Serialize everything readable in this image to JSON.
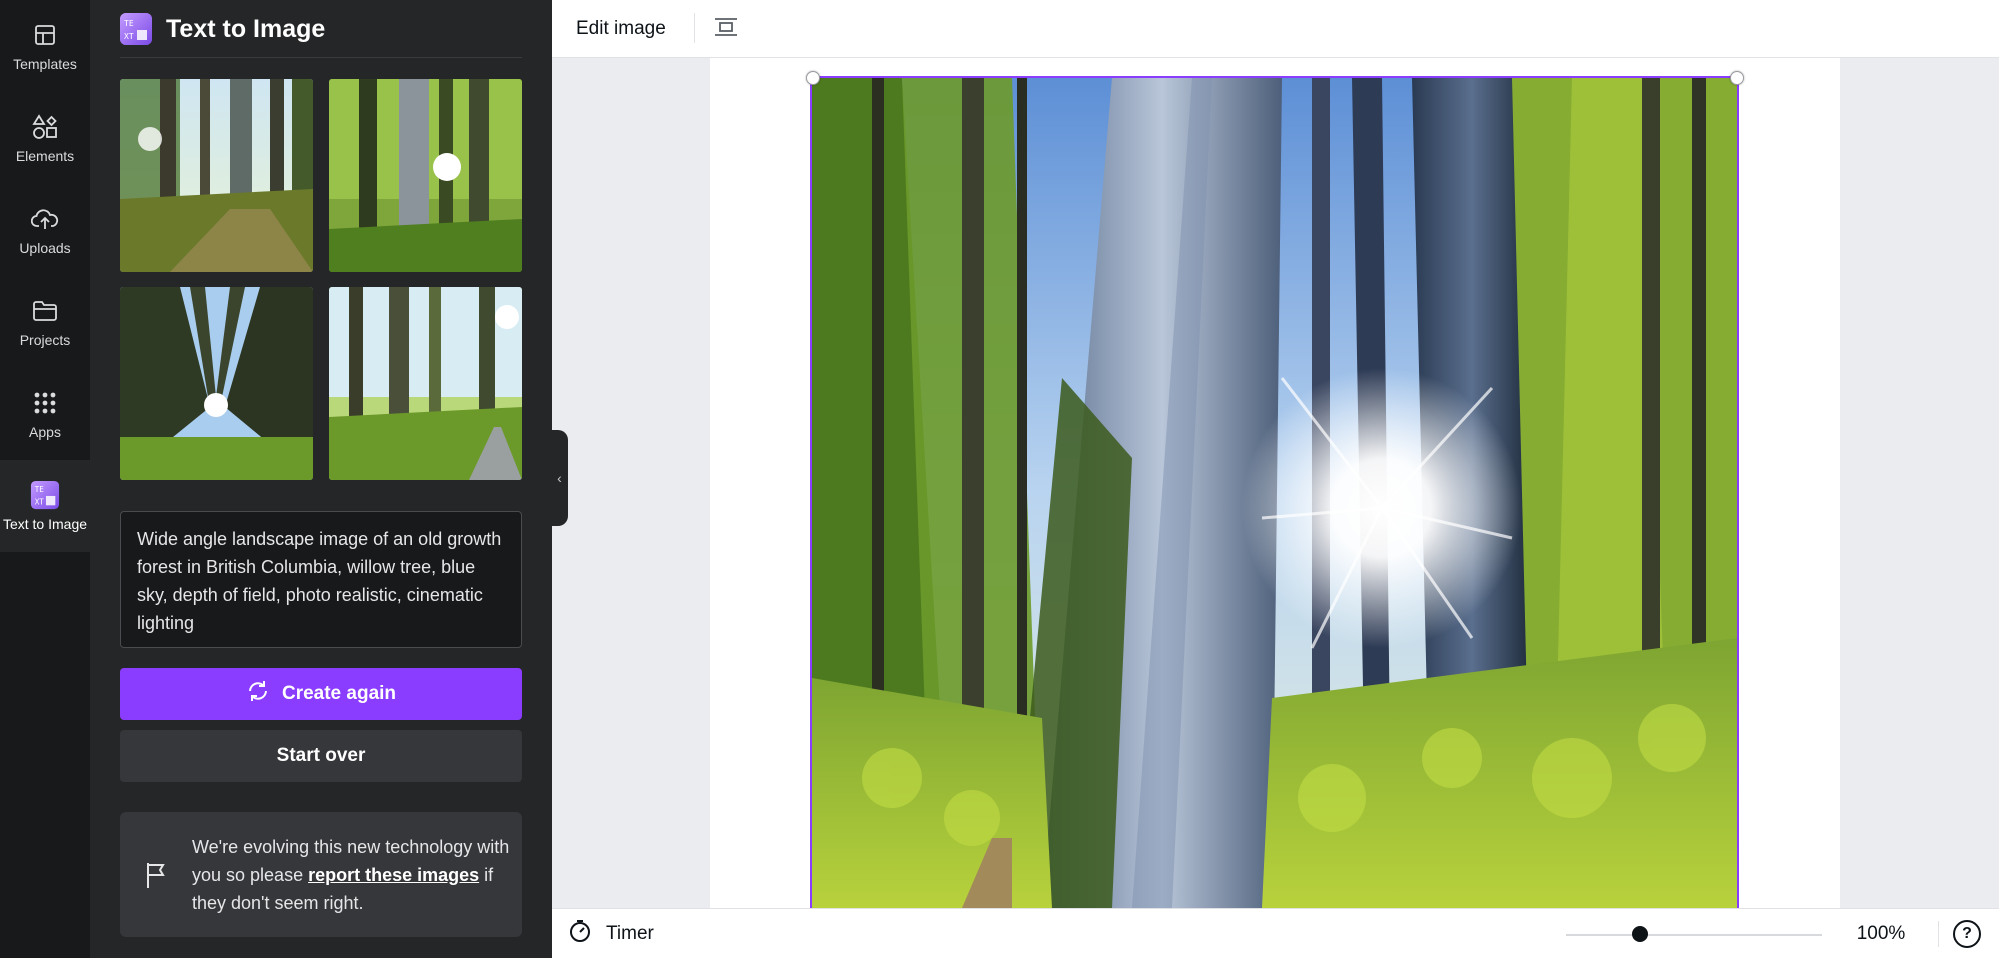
{
  "rail": {
    "items": [
      {
        "label": "Templates",
        "icon": "templates-icon"
      },
      {
        "label": "Elements",
        "icon": "elements-icon"
      },
      {
        "label": "Uploads",
        "icon": "uploads-icon"
      },
      {
        "label": "Projects",
        "icon": "projects-icon"
      },
      {
        "label": "Apps",
        "icon": "apps-icon"
      },
      {
        "label": "Text to Image",
        "icon": "text-to-image-icon",
        "active": true
      }
    ]
  },
  "panel": {
    "title": "Text to Image",
    "badge_text": "T E X T",
    "prompt": "Wide angle landscape image of an old growth forest in British Columbia, willow tree, blue sky, depth of field, photo realistic, cinematic lighting",
    "create_again_label": "Create again",
    "start_over_label": "Start over",
    "notice_prefix": "We're evolving this new technology with you so please ",
    "notice_link": "report these images",
    "notice_suffix": " if they don't seem right."
  },
  "toolbar": {
    "edit_image_label": "Edit image"
  },
  "bottombar": {
    "timer_label": "Timer",
    "zoom_label": "100%",
    "zoom_level": 0.26,
    "help_label": "?"
  },
  "colors": {
    "accent": "#8b3dff",
    "rail_bg": "#18191b",
    "panel_bg": "#252627"
  }
}
